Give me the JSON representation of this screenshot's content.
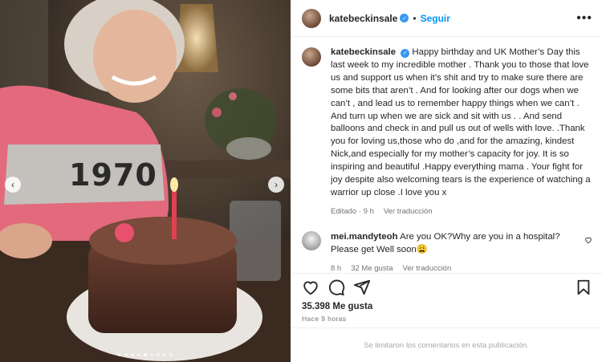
{
  "post": {
    "username": "katebeckinsale",
    "separator": "•",
    "follow_label": "Seguir",
    "more_label": "•••"
  },
  "caption": {
    "username": "katebeckinsale",
    "text": "Happy birthday and UK Mother’s Day this last week to my incredible mother . Thank you to those that love us and support us when it’s shit and try to make sure there are some bits that aren’t . And for looking after our dogs when we can’t , and lead us to remember happy things when we can’t . And turn up when we are sick and sit with us . . And send balloons and check in and pull us out of wells with love. .Thank you for loving us,those who do ,and for the amazing, kindest Nick,and especially for my mother’s capacity for joy. It is so inspiring and beautiful .Happy everything mama . Your fight for joy despite also welcoming tears is the experience of watching a warrior up close .I love you x",
    "edited_label": "Editado · 9 h",
    "translate_label": "Ver traducción"
  },
  "comment": {
    "username": "mei.mandyteoh",
    "text": "Are you OK?Why are you in a hospital? Please get Well soon😩",
    "time": "8 h",
    "likes": "32 Me gusta",
    "translate_label": "Ver traducción"
  },
  "photo": {
    "sweater_text": "1970",
    "slide_count": 9,
    "active_slide": 4
  },
  "engagement": {
    "likes": "35.398 Me gusta",
    "time_ago": "Hace 9 horas"
  },
  "footer": {
    "comments_disabled": "Se limitaron los comentarios en esta publicación."
  },
  "colors": {
    "accent": "#0095f6",
    "verified": "#3897f0",
    "meta_text": "#737373"
  }
}
